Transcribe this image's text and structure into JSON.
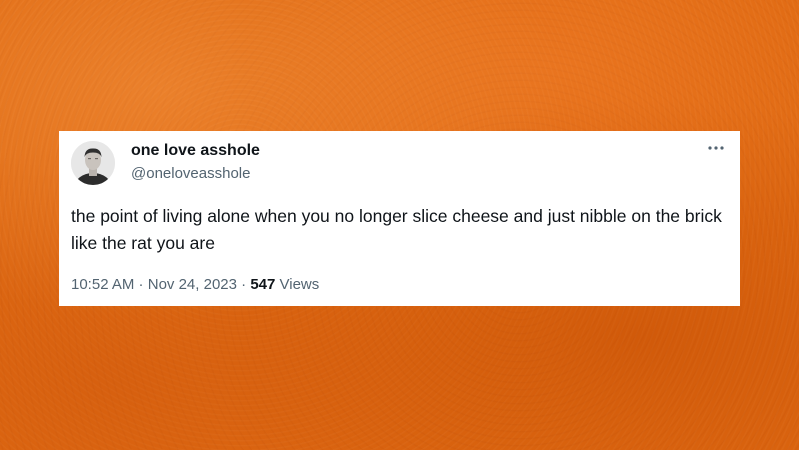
{
  "tweet": {
    "display_name": "one love asshole",
    "handle": "@oneloveasshole",
    "text": "the point of living alone when you no longer slice cheese and just nibble on the brick like the rat you are",
    "time": "10:52 AM",
    "separator": " · ",
    "date": "Nov 24, 2023",
    "views_count": "547",
    "views_label": "Views",
    "more_icon": "more-horizontal-icon",
    "avatar_icon": "profile-photo"
  },
  "colors": {
    "background": "#e06a12",
    "card": "#ffffff",
    "primary_text": "#0f1419",
    "secondary_text": "#536471"
  }
}
